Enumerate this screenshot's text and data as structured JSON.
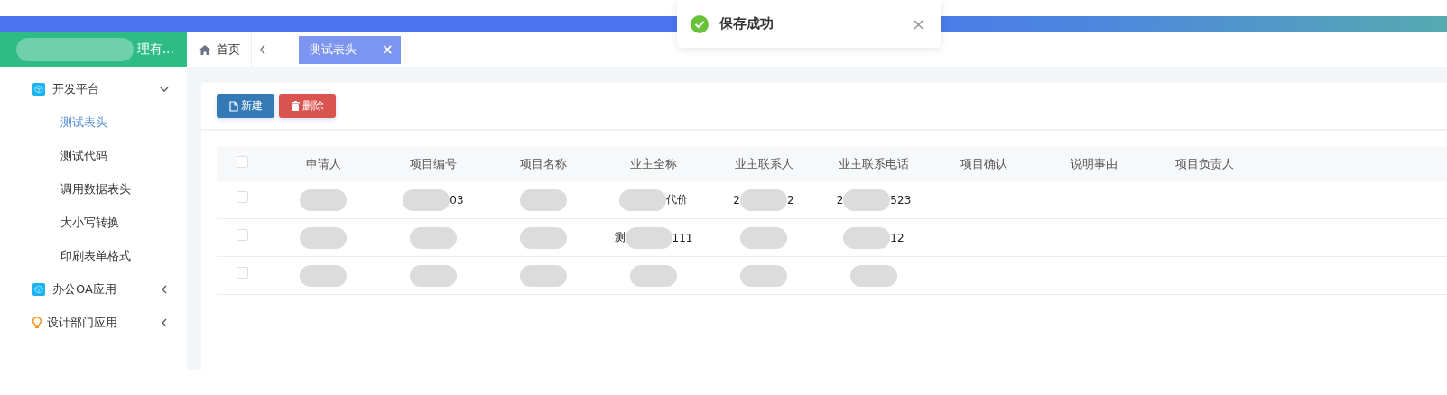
{
  "brand": {
    "title": "理有..."
  },
  "sidebar": {
    "items": [
      {
        "label": "开发平台",
        "kind": "cube",
        "expanded": true,
        "children": [
          {
            "label": "测试表头",
            "selected": true
          },
          {
            "label": "测试代码",
            "selected": false
          },
          {
            "label": "调用数据表头",
            "selected": false
          },
          {
            "label": "大小写转换",
            "selected": false
          },
          {
            "label": "印刷表单格式",
            "selected": false
          }
        ]
      },
      {
        "label": "办公OA应用",
        "kind": "cube",
        "expanded": false
      },
      {
        "label": "设计部门应用",
        "kind": "bulb",
        "expanded": false
      }
    ]
  },
  "tabs": {
    "home": "首页",
    "items": [
      {
        "label": "测试表头",
        "selected": true,
        "close": "×"
      }
    ]
  },
  "toolbar": [
    {
      "label": "新建",
      "kind": "new"
    },
    {
      "label": "删除",
      "kind": "delete"
    }
  ],
  "table": {
    "all_checked": false,
    "columns": [
      "申请人",
      "项目编号",
      "项目名称",
      "业主全称",
      "业主联系人",
      "业主联系电话",
      "项目确认",
      "说明事由",
      "项目负责人"
    ],
    "rows": [
      {
        "checked": false,
        "cells": [
          {
            "blurred": true
          },
          {
            "blurred": true,
            "after": "03"
          },
          {
            "blurred": true
          },
          {
            "blurred": true,
            "after": "代价"
          },
          {
            "blurred": true,
            "before": "2",
            "after": "2"
          },
          {
            "blurred": true,
            "before": "2",
            "after": "523"
          },
          {},
          {},
          {}
        ]
      },
      {
        "checked": false,
        "cells": [
          {
            "blurred": true
          },
          {
            "blurred": true
          },
          {
            "blurred": true
          },
          {
            "blurred": true,
            "before": "测",
            "after": "111"
          },
          {
            "blurred": true
          },
          {
            "blurred": true,
            "after": "12"
          },
          {},
          {},
          {}
        ]
      },
      {
        "checked": false,
        "cells": [
          {
            "blurred": true
          },
          {
            "blurred": true
          },
          {
            "blurred": true
          },
          {
            "blurred": true
          },
          {
            "blurred": true
          },
          {
            "blurred": true
          },
          {},
          {},
          {}
        ]
      }
    ]
  },
  "toast": {
    "message": "保存成功",
    "kind": "success",
    "close": "×"
  }
}
